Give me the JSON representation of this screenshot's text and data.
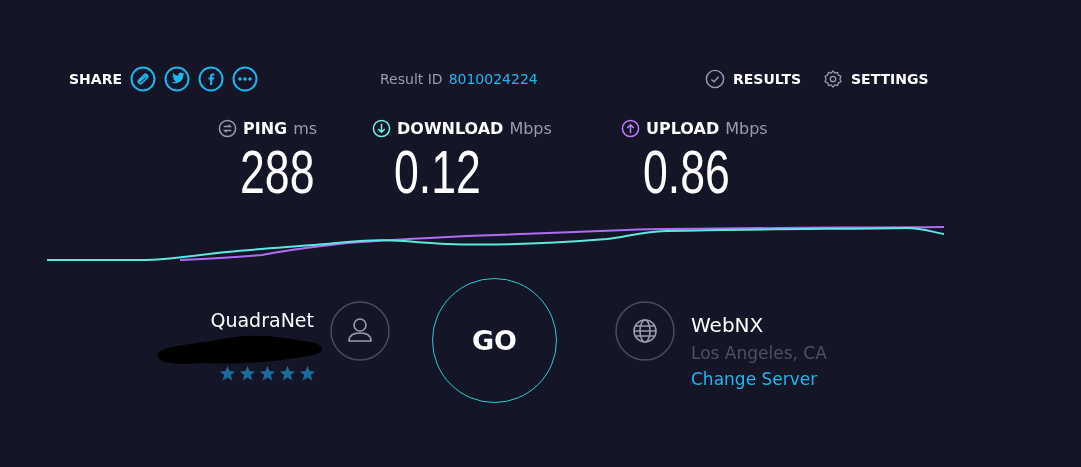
{
  "share": {
    "label": "SHARE"
  },
  "result": {
    "label": "Result ID",
    "id": "8010024224"
  },
  "nav": [
    {
      "kind": "results",
      "label": "RESULTS"
    },
    {
      "kind": "settings",
      "label": "SETTINGS"
    }
  ],
  "metrics": [
    {
      "kind": "ping",
      "label": "PING",
      "unit": "ms",
      "value": "288",
      "color": "#9a9cb0"
    },
    {
      "kind": "download",
      "label": "DOWNLOAD",
      "unit": "Mbps",
      "value": "0.12",
      "color": "#6ff3e4"
    },
    {
      "kind": "upload",
      "label": "UPLOAD",
      "unit": "Mbps",
      "value": "0.86",
      "color": "#c07cff"
    }
  ],
  "go_button": "GO",
  "isp": {
    "name": "QuadraNet",
    "stars": 5
  },
  "server": {
    "name": "WebNX",
    "location": "Los Angeles, CA",
    "link": "Change Server"
  }
}
